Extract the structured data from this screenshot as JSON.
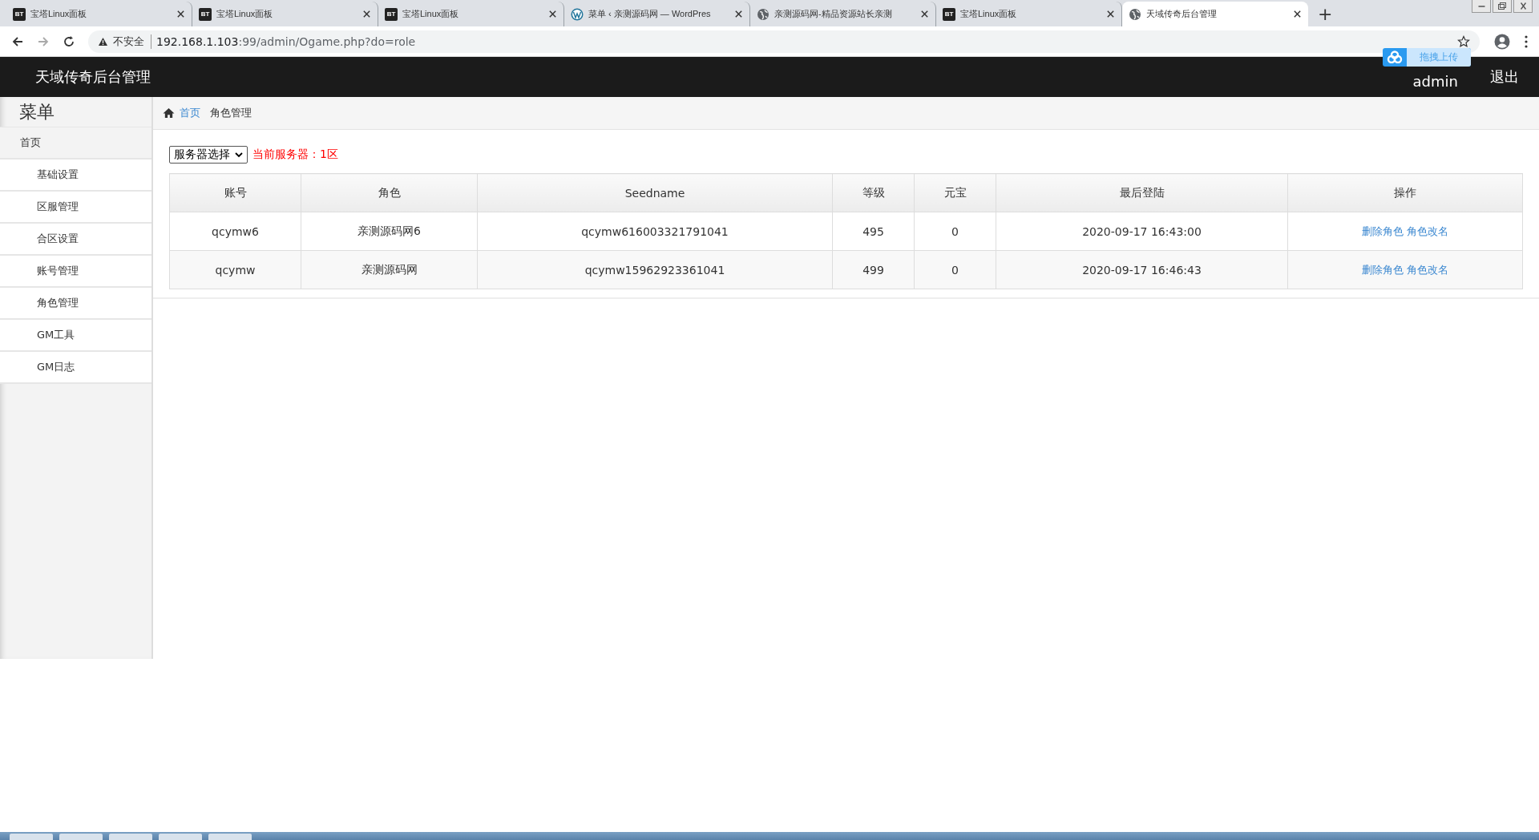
{
  "browser": {
    "tabs": [
      {
        "kind": "badge",
        "favicon_text": "BT",
        "label": "宝塔Linux面板",
        "selected": false
      },
      {
        "kind": "badge",
        "favicon_text": "BT",
        "label": "宝塔Linux面板",
        "selected": false
      },
      {
        "kind": "badge",
        "favicon_text": "BT",
        "label": "宝塔Linux面板",
        "selected": false
      },
      {
        "kind": "wordpress",
        "label": "菜单 ‹ 亲测源码网 — WordPres",
        "selected": false
      },
      {
        "kind": "globe",
        "label": "亲测源码网-精品资源站长亲测",
        "selected": false
      },
      {
        "kind": "badge",
        "favicon_text": "BT",
        "label": "宝塔Linux面板",
        "selected": false
      },
      {
        "kind": "globe",
        "label": "天域传奇后台管理",
        "selected": true
      }
    ],
    "new_tab": "+",
    "security": "不安全",
    "url_host": "192.168.1.103",
    "url_rest": ":99/admin/Ogame.php?do=role"
  },
  "header": {
    "title": "天域传奇后台管理",
    "upload_badge": "拖拽上传",
    "user": "admin",
    "logout": "退出"
  },
  "sidebar": {
    "title": "菜单",
    "items": [
      {
        "label": "首页",
        "children": [
          {
            "label": "基础设置"
          },
          {
            "label": "区服管理"
          },
          {
            "label": "合区设置"
          },
          {
            "label": "账号管理"
          },
          {
            "label": "角色管理"
          },
          {
            "label": "GM工具"
          },
          {
            "label": "GM日志"
          }
        ]
      }
    ]
  },
  "breadcrumb": [
    {
      "label": "首页",
      "kind": "link"
    },
    {
      "label": "角色管理",
      "kind": "current"
    }
  ],
  "server_select": {
    "value": "服务器选择"
  },
  "current_server": "当前服务器：1区",
  "table": {
    "columns": [
      "账号",
      "角色",
      "Seedname",
      "等级",
      "元宝",
      "最后登陆",
      "操作"
    ],
    "rows": [
      {
        "cells": [
          "qcymw6",
          "亲测源码网6",
          "qcymw616003321791041",
          "495",
          "0",
          "2020-09-17 16:43:00"
        ],
        "actions": [
          "删除角色",
          "角色改名"
        ]
      },
      {
        "cells": [
          "qcymw",
          "亲测源码网",
          "qcymw15962923361041",
          "499",
          "0",
          "2020-09-17 16:46:43"
        ],
        "actions": [
          "删除角色",
          "角色改名"
        ]
      }
    ]
  }
}
